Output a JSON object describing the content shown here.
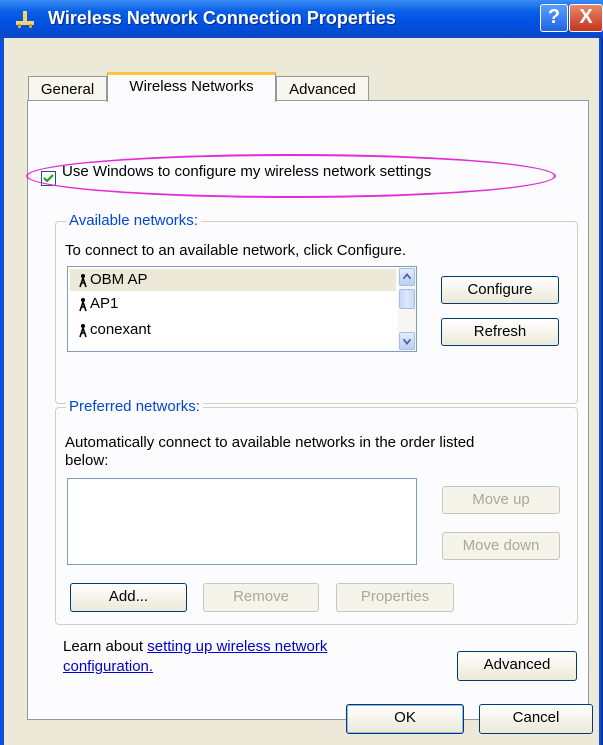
{
  "window": {
    "title": "Wireless Network Connection Properties",
    "help_label": "?",
    "close_label": "X"
  },
  "tabs": [
    {
      "label": "General",
      "active": false
    },
    {
      "label": "Wireless Networks",
      "active": true
    },
    {
      "label": "Advanced",
      "active": false
    }
  ],
  "use_windows": {
    "label": "Use Windows to configure my wireless network settings",
    "checked": true
  },
  "available": {
    "legend": "Available networks:",
    "description": "To connect to an available network, click Configure.",
    "networks": [
      "OBM AP",
      "AP1",
      "conexant"
    ],
    "selected_index": 0,
    "configure_label": "Configure",
    "refresh_label": "Refresh"
  },
  "preferred": {
    "legend": "Preferred networks:",
    "description_line1": "Automatically connect to available networks in the order listed",
    "description_line2": "below:",
    "move_up_label": "Move up",
    "move_down_label": "Move down",
    "add_label": "Add...",
    "remove_label": "Remove",
    "properties_label": "Properties"
  },
  "learn": {
    "prefix": "Learn about ",
    "link_line1": "setting up wireless network",
    "link_line2": "configuration.",
    "advanced_label": "Advanced"
  },
  "footer": {
    "ok_label": "OK",
    "cancel_label": "Cancel"
  },
  "colors": {
    "accent_ellipse": "#e42bd6",
    "titlebar": "#0a50d8",
    "group_legend": "#0046d5"
  }
}
